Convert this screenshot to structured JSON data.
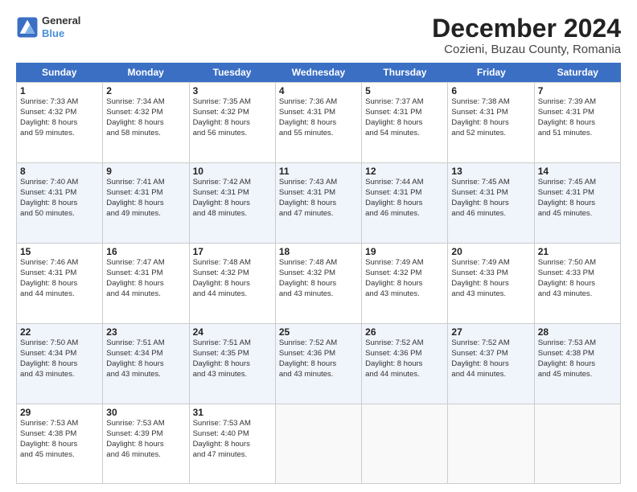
{
  "logo": {
    "line1": "General",
    "line2": "Blue"
  },
  "title": "December 2024",
  "subtitle": "Cozieni, Buzau County, Romania",
  "header_days": [
    "Sunday",
    "Monday",
    "Tuesday",
    "Wednesday",
    "Thursday",
    "Friday",
    "Saturday"
  ],
  "weeks": [
    [
      {
        "day": "1",
        "lines": [
          "Sunrise: 7:33 AM",
          "Sunset: 4:32 PM",
          "Daylight: 8 hours",
          "and 59 minutes."
        ]
      },
      {
        "day": "2",
        "lines": [
          "Sunrise: 7:34 AM",
          "Sunset: 4:32 PM",
          "Daylight: 8 hours",
          "and 58 minutes."
        ]
      },
      {
        "day": "3",
        "lines": [
          "Sunrise: 7:35 AM",
          "Sunset: 4:32 PM",
          "Daylight: 8 hours",
          "and 56 minutes."
        ]
      },
      {
        "day": "4",
        "lines": [
          "Sunrise: 7:36 AM",
          "Sunset: 4:31 PM",
          "Daylight: 8 hours",
          "and 55 minutes."
        ]
      },
      {
        "day": "5",
        "lines": [
          "Sunrise: 7:37 AM",
          "Sunset: 4:31 PM",
          "Daylight: 8 hours",
          "and 54 minutes."
        ]
      },
      {
        "day": "6",
        "lines": [
          "Sunrise: 7:38 AM",
          "Sunset: 4:31 PM",
          "Daylight: 8 hours",
          "and 52 minutes."
        ]
      },
      {
        "day": "7",
        "lines": [
          "Sunrise: 7:39 AM",
          "Sunset: 4:31 PM",
          "Daylight: 8 hours",
          "and 51 minutes."
        ]
      }
    ],
    [
      {
        "day": "8",
        "lines": [
          "Sunrise: 7:40 AM",
          "Sunset: 4:31 PM",
          "Daylight: 8 hours",
          "and 50 minutes."
        ]
      },
      {
        "day": "9",
        "lines": [
          "Sunrise: 7:41 AM",
          "Sunset: 4:31 PM",
          "Daylight: 8 hours",
          "and 49 minutes."
        ]
      },
      {
        "day": "10",
        "lines": [
          "Sunrise: 7:42 AM",
          "Sunset: 4:31 PM",
          "Daylight: 8 hours",
          "and 48 minutes."
        ]
      },
      {
        "day": "11",
        "lines": [
          "Sunrise: 7:43 AM",
          "Sunset: 4:31 PM",
          "Daylight: 8 hours",
          "and 47 minutes."
        ]
      },
      {
        "day": "12",
        "lines": [
          "Sunrise: 7:44 AM",
          "Sunset: 4:31 PM",
          "Daylight: 8 hours",
          "and 46 minutes."
        ]
      },
      {
        "day": "13",
        "lines": [
          "Sunrise: 7:45 AM",
          "Sunset: 4:31 PM",
          "Daylight: 8 hours",
          "and 46 minutes."
        ]
      },
      {
        "day": "14",
        "lines": [
          "Sunrise: 7:45 AM",
          "Sunset: 4:31 PM",
          "Daylight: 8 hours",
          "and 45 minutes."
        ]
      }
    ],
    [
      {
        "day": "15",
        "lines": [
          "Sunrise: 7:46 AM",
          "Sunset: 4:31 PM",
          "Daylight: 8 hours",
          "and 44 minutes."
        ]
      },
      {
        "day": "16",
        "lines": [
          "Sunrise: 7:47 AM",
          "Sunset: 4:31 PM",
          "Daylight: 8 hours",
          "and 44 minutes."
        ]
      },
      {
        "day": "17",
        "lines": [
          "Sunrise: 7:48 AM",
          "Sunset: 4:32 PM",
          "Daylight: 8 hours",
          "and 44 minutes."
        ]
      },
      {
        "day": "18",
        "lines": [
          "Sunrise: 7:48 AM",
          "Sunset: 4:32 PM",
          "Daylight: 8 hours",
          "and 43 minutes."
        ]
      },
      {
        "day": "19",
        "lines": [
          "Sunrise: 7:49 AM",
          "Sunset: 4:32 PM",
          "Daylight: 8 hours",
          "and 43 minutes."
        ]
      },
      {
        "day": "20",
        "lines": [
          "Sunrise: 7:49 AM",
          "Sunset: 4:33 PM",
          "Daylight: 8 hours",
          "and 43 minutes."
        ]
      },
      {
        "day": "21",
        "lines": [
          "Sunrise: 7:50 AM",
          "Sunset: 4:33 PM",
          "Daylight: 8 hours",
          "and 43 minutes."
        ]
      }
    ],
    [
      {
        "day": "22",
        "lines": [
          "Sunrise: 7:50 AM",
          "Sunset: 4:34 PM",
          "Daylight: 8 hours",
          "and 43 minutes."
        ]
      },
      {
        "day": "23",
        "lines": [
          "Sunrise: 7:51 AM",
          "Sunset: 4:34 PM",
          "Daylight: 8 hours",
          "and 43 minutes."
        ]
      },
      {
        "day": "24",
        "lines": [
          "Sunrise: 7:51 AM",
          "Sunset: 4:35 PM",
          "Daylight: 8 hours",
          "and 43 minutes."
        ]
      },
      {
        "day": "25",
        "lines": [
          "Sunrise: 7:52 AM",
          "Sunset: 4:36 PM",
          "Daylight: 8 hours",
          "and 43 minutes."
        ]
      },
      {
        "day": "26",
        "lines": [
          "Sunrise: 7:52 AM",
          "Sunset: 4:36 PM",
          "Daylight: 8 hours",
          "and 44 minutes."
        ]
      },
      {
        "day": "27",
        "lines": [
          "Sunrise: 7:52 AM",
          "Sunset: 4:37 PM",
          "Daylight: 8 hours",
          "and 44 minutes."
        ]
      },
      {
        "day": "28",
        "lines": [
          "Sunrise: 7:53 AM",
          "Sunset: 4:38 PM",
          "Daylight: 8 hours",
          "and 45 minutes."
        ]
      }
    ],
    [
      {
        "day": "29",
        "lines": [
          "Sunrise: 7:53 AM",
          "Sunset: 4:38 PM",
          "Daylight: 8 hours",
          "and 45 minutes."
        ]
      },
      {
        "day": "30",
        "lines": [
          "Sunrise: 7:53 AM",
          "Sunset: 4:39 PM",
          "Daylight: 8 hours",
          "and 46 minutes."
        ]
      },
      {
        "day": "31",
        "lines": [
          "Sunrise: 7:53 AM",
          "Sunset: 4:40 PM",
          "Daylight: 8 hours",
          "and 47 minutes."
        ]
      },
      {
        "day": "",
        "lines": []
      },
      {
        "day": "",
        "lines": []
      },
      {
        "day": "",
        "lines": []
      },
      {
        "day": "",
        "lines": []
      }
    ]
  ]
}
